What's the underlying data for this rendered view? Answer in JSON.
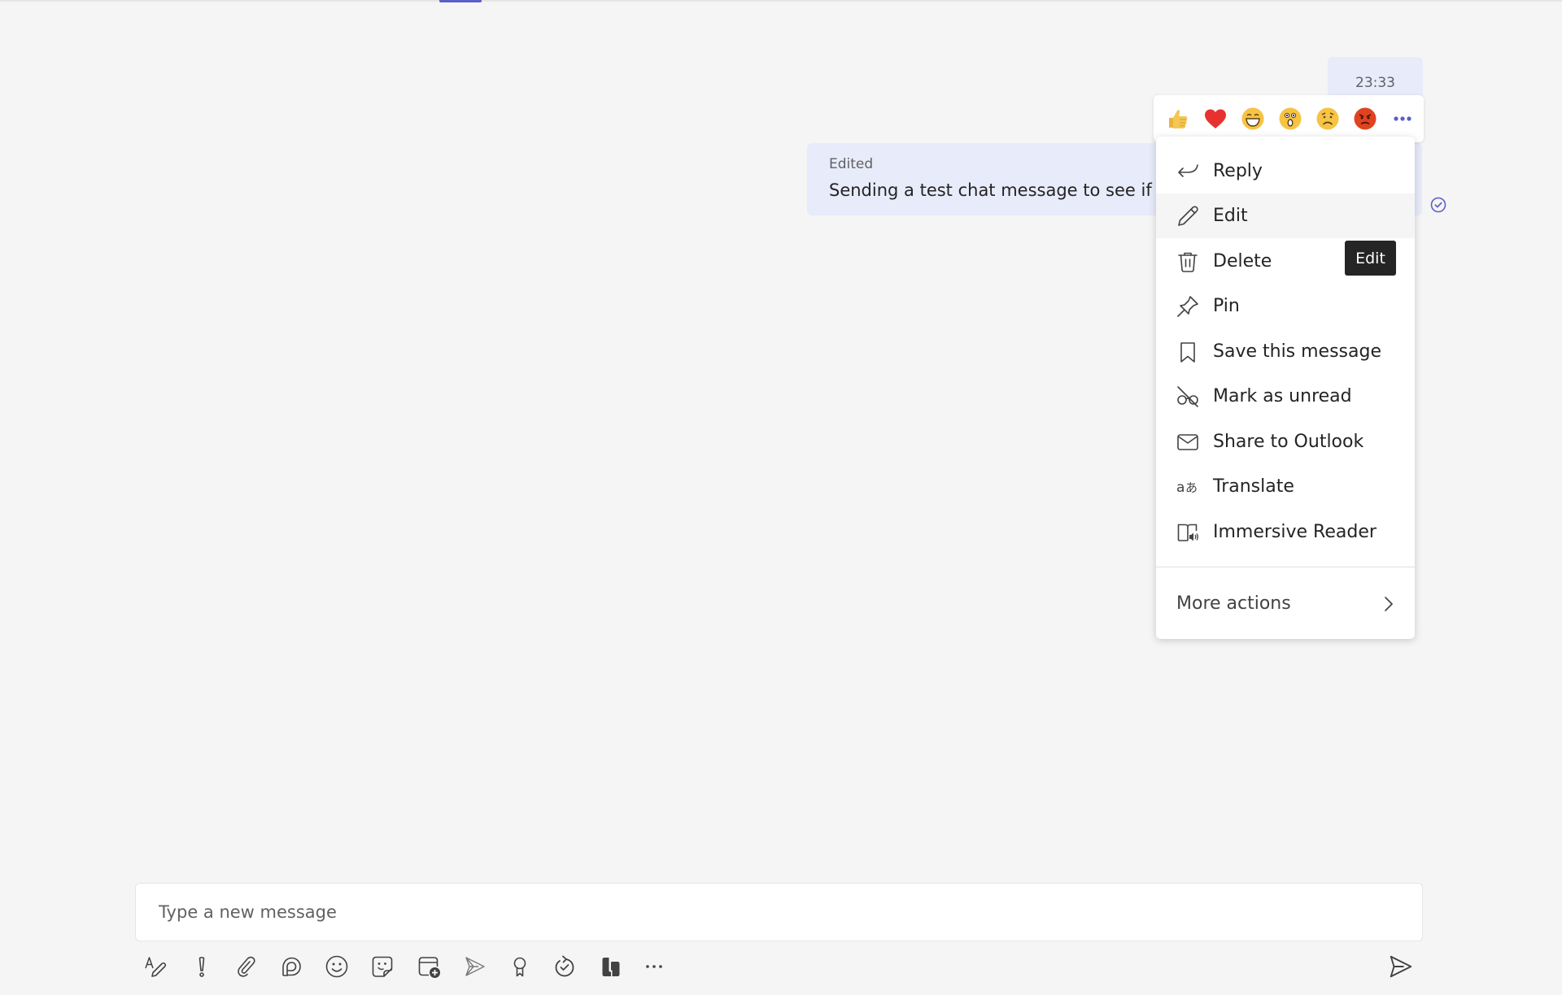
{
  "header": {
    "active_tab_color": "#5b5fc7"
  },
  "chat": {
    "timestamp": "23:33",
    "message": {
      "status": "Edited",
      "text": "Sending a test chat message to see if",
      "read_receipt": "read-check-icon"
    }
  },
  "reactions": [
    {
      "name": "like",
      "icon": "thumbs-up-icon"
    },
    {
      "name": "heart",
      "icon": "heart-icon"
    },
    {
      "name": "laugh",
      "icon": "laughing-face-icon"
    },
    {
      "name": "surprised",
      "icon": "surprised-face-icon"
    },
    {
      "name": "sad",
      "icon": "sad-face-icon"
    },
    {
      "name": "angry",
      "icon": "angry-face-icon"
    },
    {
      "name": "more-reactions",
      "icon": "more-horizontal-icon"
    }
  ],
  "context_menu": {
    "items": [
      {
        "label": "Reply",
        "icon": "reply-icon"
      },
      {
        "label": "Edit",
        "icon": "pencil-icon",
        "hovered": true
      },
      {
        "label": "Delete",
        "icon": "trash-icon"
      },
      {
        "label": "Pin",
        "icon": "pin-icon"
      },
      {
        "label": "Save this message",
        "icon": "bookmark-icon"
      },
      {
        "label": "Mark as unread",
        "icon": "glasses-off-icon"
      },
      {
        "label": "Share to Outlook",
        "icon": "mail-icon"
      },
      {
        "label": "Translate",
        "icon": "translate-icon"
      },
      {
        "label": "Immersive Reader",
        "icon": "immersive-reader-icon"
      }
    ],
    "more_actions": "More actions"
  },
  "tooltip": {
    "text": "Edit"
  },
  "compose": {
    "placeholder": "Type a new message",
    "value": ""
  },
  "toolbar": [
    {
      "name": "format",
      "icon": "format-icon"
    },
    {
      "name": "priority",
      "icon": "exclamation-icon"
    },
    {
      "name": "attach",
      "icon": "paperclip-icon"
    },
    {
      "name": "loop",
      "icon": "loop-icon"
    },
    {
      "name": "emoji",
      "icon": "emoji-icon"
    },
    {
      "name": "sticker",
      "icon": "sticker-icon"
    },
    {
      "name": "schedule-meeting",
      "icon": "calendar-add-icon"
    },
    {
      "name": "send-later",
      "icon": "send-outline-icon"
    },
    {
      "name": "praise",
      "icon": "ribbon-icon"
    },
    {
      "name": "updates",
      "icon": "refresh-check-icon"
    },
    {
      "name": "apps",
      "icon": "stream-icon"
    },
    {
      "name": "more-options",
      "icon": "ellipsis-icon"
    }
  ],
  "send_button": {
    "icon": "send-icon"
  }
}
